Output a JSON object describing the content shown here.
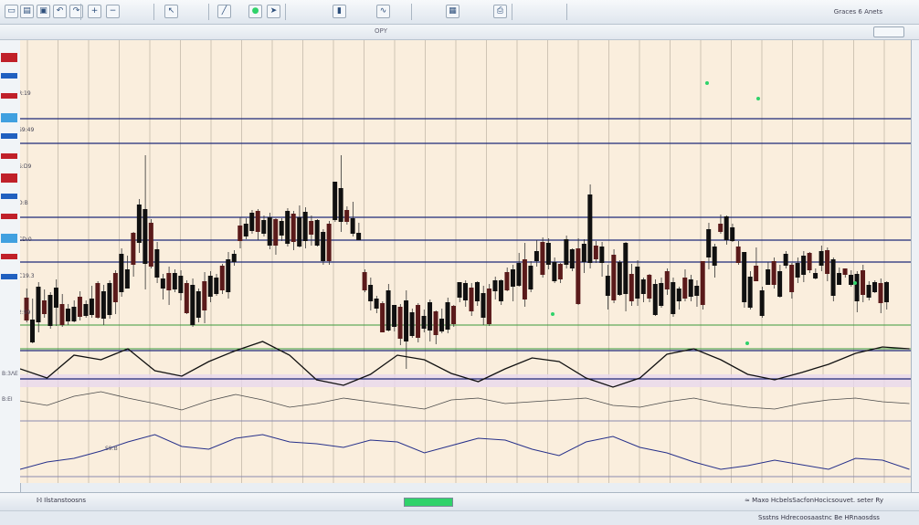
{
  "window": {
    "chart_name": "ΟΡΥ"
  },
  "toolbar": {
    "icons": [
      "new-chart-icon",
      "open-icon",
      "save-icon",
      "undo-icon",
      "redo-icon",
      "zoom-in-icon",
      "zoom-out-icon",
      "cursor-icon",
      "line-tool-icon",
      "green-circle-icon",
      "arrow-icon",
      "chart-candle-icon",
      "line-chart-icon",
      "grid-icon",
      "print-icon"
    ],
    "status_right": "Graces 6 Anets"
  },
  "panel_labels": {
    "osc_top": "B:3ΛΕ",
    "osc_low": "B:ΕΙ",
    "lower_label": "S9:B"
  },
  "bottom": {
    "left_text": "ℍ Ilstanstoosns",
    "right_text": "≈ Maxo HcbelsSacfonHocicsouvet. seter Ry",
    "progress": 1.0
  },
  "footer": {
    "right_text": "Ssstns Hdrecoosaastnc   Be  HRnaosdss"
  },
  "colors": {
    "background": "#faeedd",
    "grid": "#cfc4b4",
    "hline": "#1f2a78",
    "accent_green": "#2fd26a",
    "bull": "#5a1a1a",
    "bear": "#101010",
    "red": "#c0202a"
  },
  "chart_data": {
    "type": "candlestick",
    "title": "",
    "grid": true,
    "candles": [
      [
        272,
        282,
        307,
        309
      ],
      [
        283,
        306,
        331,
        332
      ],
      [
        265,
        270,
        309,
        320
      ],
      [
        273,
        285,
        300,
        304
      ],
      [
        276,
        279,
        313,
        316
      ],
      [
        262,
        271,
        293,
        313
      ],
      [
        278,
        289,
        312,
        314
      ],
      [
        289,
        294,
        308,
        312
      ],
      [
        285,
        292,
        308,
        309
      ],
      [
        275,
        281,
        303,
        307
      ],
      [
        285,
        289,
        302,
        304
      ],
      [
        269,
        283,
        301,
        304
      ],
      [
        264,
        266,
        304,
        305
      ],
      [
        268,
        275,
        305,
        312
      ],
      [
        263,
        266,
        301,
        305
      ],
      [
        252,
        255,
        287,
        300
      ],
      [
        228,
        234,
        276,
        281
      ],
      [
        236,
        251,
        272,
        272
      ],
      [
        210,
        211,
        246,
        259
      ],
      [
        174,
        180,
        222,
        233
      ],
      [
        126,
        185,
        245,
        273
      ],
      [
        196,
        200,
        248,
        250
      ],
      [
        221,
        229,
        260,
        266
      ],
      [
        256,
        261,
        272,
        284
      ],
      [
        248,
        255,
        274,
        290
      ],
      [
        251,
        255,
        273,
        276
      ],
      [
        252,
        258,
        277,
        285
      ],
      [
        263,
        266,
        299,
        300
      ],
      [
        261,
        268,
        312,
        314
      ],
      [
        272,
        275,
        304,
        309
      ],
      [
        254,
        264,
        296,
        310
      ],
      [
        253,
        258,
        281,
        287
      ],
      [
        256,
        260,
        278,
        280
      ],
      [
        245,
        247,
        274,
        278
      ],
      [
        232,
        240,
        276,
        283
      ],
      [
        230,
        234,
        243,
        247
      ],
      [
        194,
        203,
        220,
        228
      ],
      [
        195,
        201,
        215,
        218
      ],
      [
        186,
        189,
        209,
        212
      ],
      [
        185,
        187,
        210,
        219
      ],
      [
        192,
        197,
        212,
        215
      ],
      [
        189,
        194,
        225,
        229
      ],
      [
        195,
        196,
        225,
        235
      ],
      [
        195,
        198,
        214,
        220
      ],
      [
        184,
        187,
        223,
        226
      ],
      [
        187,
        190,
        221,
        230
      ],
      [
        181,
        194,
        226,
        227
      ],
      [
        183,
        188,
        220,
        228
      ],
      [
        192,
        198,
        213,
        225
      ],
      [
        196,
        197,
        225,
        226
      ],
      [
        207,
        210,
        242,
        246
      ],
      [
        198,
        201,
        242,
        246
      ],
      [
        155,
        155,
        197,
        199
      ],
      [
        126,
        162,
        199,
        210
      ],
      [
        182,
        186,
        199,
        202
      ],
      [
        177,
        195,
        212,
        215
      ],
      [
        200,
        211,
        219,
        219
      ],
      [
        251,
        254,
        274,
        276
      ],
      [
        260,
        268,
        286,
        296
      ],
      [
        280,
        283,
        294,
        299
      ],
      [
        286,
        288,
        320,
        320
      ],
      [
        267,
        274,
        318,
        319
      ],
      [
        290,
        290,
        314,
        319
      ],
      [
        289,
        292,
        327,
        334
      ],
      [
        274,
        285,
        330,
        360
      ],
      [
        294,
        298,
        324,
        326
      ],
      [
        288,
        290,
        326,
        331
      ],
      [
        295,
        302,
        316,
        320
      ],
      [
        284,
        287,
        318,
        330
      ],
      [
        296,
        297,
        323,
        333
      ],
      [
        294,
        305,
        319,
        321
      ],
      [
        282,
        287,
        317,
        321
      ],
      [
        290,
        291,
        311,
        314
      ],
      [
        265,
        265,
        282,
        287
      ],
      [
        263,
        266,
        285,
        292
      ],
      [
        266,
        271,
        297,
        302
      ],
      [
        264,
        265,
        286,
        291
      ],
      [
        269,
        277,
        304,
        312
      ],
      [
        267,
        272,
        311,
        313
      ],
      [
        259,
        263,
        275,
        284
      ],
      [
        262,
        263,
        286,
        290
      ],
      [
        249,
        254,
        274,
        275
      ],
      [
        246,
        251,
        270,
        286
      ],
      [
        233,
        244,
        269,
        270
      ],
      [
        222,
        240,
        284,
        292
      ],
      [
        242,
        247,
        273,
        276
      ],
      [
        219,
        231,
        242,
        248
      ],
      [
        216,
        221,
        257,
        260
      ],
      [
        217,
        222,
        246,
        251
      ],
      [
        238,
        243,
        264,
        266
      ],
      [
        244,
        245,
        262,
        266
      ],
      [
        214,
        218,
        246,
        250
      ],
      [
        228,
        229,
        250,
        253
      ],
      [
        217,
        228,
        289,
        290
      ],
      [
        218,
        223,
        243,
        255
      ],
      [
        158,
        169,
        244,
        250
      ],
      [
        220,
        225,
        240,
        244
      ],
      [
        221,
        226,
        244,
        259
      ],
      [
        246,
        258,
        280,
        295
      ],
      [
        229,
        235,
        285,
        288
      ],
      [
        241,
        243,
        279,
        280
      ],
      [
        221,
        222,
        278,
        297
      ],
      [
        245,
        256,
        286,
        291
      ],
      [
        241,
        248,
        283,
        291
      ],
      [
        260,
        262,
        278,
        287
      ],
      [
        256,
        257,
        283,
        287
      ],
      [
        262,
        267,
        301,
        302
      ],
      [
        260,
        266,
        291,
        293
      ],
      [
        250,
        253,
        273,
        279
      ],
      [
        260,
        265,
        300,
        303
      ],
      [
        270,
        272,
        286,
        295
      ],
      [
        251,
        260,
        283,
        286
      ],
      [
        257,
        262,
        281,
        286
      ],
      [
        263,
        269,
        280,
        292
      ],
      [
        242,
        242,
        290,
        295
      ],
      [
        200,
        207,
        238,
        251
      ],
      [
        223,
        226,
        247,
        260
      ],
      [
        191,
        201,
        210,
        212
      ],
      [
        192,
        193,
        219,
        224
      ],
      [
        201,
        205,
        220,
        221
      ],
      [
        220,
        226,
        244,
        246
      ],
      [
        232,
        232,
        287,
        293
      ],
      [
        253,
        259,
        293,
        295
      ],
      [
        227,
        247,
        264,
        264
      ],
      [
        270,
        274,
        302,
        304
      ],
      [
        243,
        251,
        268,
        268
      ],
      [
        238,
        242,
        268,
        272
      ],
      [
        246,
        253,
        281,
        282
      ],
      [
        231,
        234,
        247,
        250
      ],
      [
        244,
        246,
        276,
        283
      ],
      [
        238,
        244,
        260,
        266
      ],
      [
        231,
        236,
        257,
        265
      ],
      [
        232,
        233,
        252,
        255
      ],
      [
        250,
        255,
        261,
        262
      ],
      [
        225,
        231,
        247,
        253
      ],
      [
        227,
        230,
        256,
        264
      ],
      [
        238,
        240,
        280,
        286
      ],
      [
        249,
        255,
        268,
        268
      ],
      [
        250,
        250,
        257,
        260
      ],
      [
        252,
        257,
        268,
        270
      ],
      [
        253,
        256,
        286,
        298
      ],
      [
        246,
        252,
        279,
        287
      ],
      [
        264,
        268,
        282,
        285
      ],
      [
        263,
        265,
        276,
        277
      ],
      [
        261,
        266,
        288,
        299
      ],
      [
        264,
        265,
        287,
        295
      ]
    ],
    "hlines": [
      86,
      113,
      194,
      219,
      243,
      340,
      371
    ],
    "green_hlines": [
      312,
      338
    ],
    "price_labels": [
      "R:19",
      "S9:49",
      "S:D9",
      "D:B",
      "CD:0",
      "C19.3",
      "2:99"
    ]
  }
}
